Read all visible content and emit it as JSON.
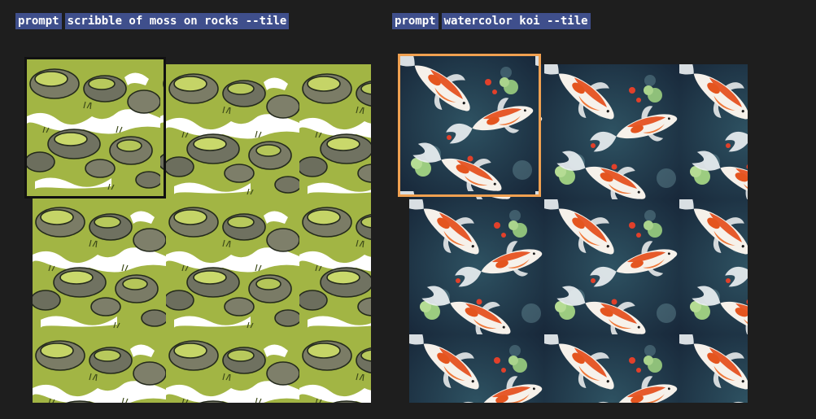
{
  "prompt_chip_label": "prompt",
  "moss": {
    "prompt_text": "scribble of moss on rocks --tile"
  },
  "koi": {
    "prompt_text": "watercolor koi --tile"
  },
  "colors": {
    "background": "#1e1e1e",
    "chip_bg": "#3f4f8c",
    "chip_text": "#ffffff",
    "moss_tile_border": "#111111",
    "koi_tile_border": "#f0a050"
  }
}
